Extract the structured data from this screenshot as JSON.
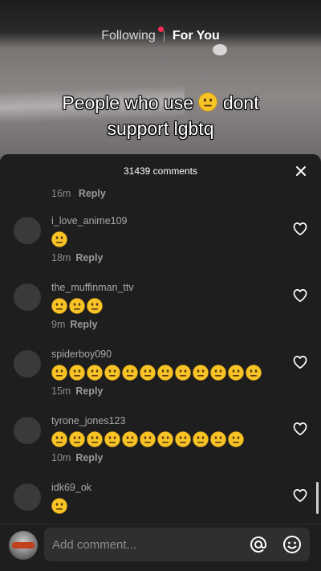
{
  "top_tabs": {
    "following": "Following",
    "for_you": "For You"
  },
  "caption": {
    "before_emoji": "People who use",
    "after_emoji": "dont",
    "line2": "support lgbtq",
    "emoji_icon": "neutral-face-emoji"
  },
  "comments_panel": {
    "count_label": "31439 comments",
    "partial_top": {
      "time": "16m",
      "reply": "Reply"
    },
    "comments": [
      {
        "username": "i_love_anime109",
        "emoji_count": 1,
        "time": "18m",
        "reply": "Reply"
      },
      {
        "username": "the_muffinman_ttv",
        "emoji_count": 3,
        "time": "9m",
        "reply": "Reply"
      },
      {
        "username": "spiderboy090",
        "emoji_count": 12,
        "time": "15m",
        "reply": "Reply"
      },
      {
        "username": "tyrone_jones123",
        "emoji_count": 11,
        "time": "10m",
        "reply": "Reply"
      },
      {
        "username": "idk69_ok",
        "emoji_count": 1,
        "time": "",
        "reply": ""
      }
    ]
  },
  "input": {
    "placeholder": "Add comment..."
  },
  "colors": {
    "panel_bg": "#1e1e1e",
    "live_dot": "#ff2d55",
    "emoji_yellow": "#f7c325"
  }
}
